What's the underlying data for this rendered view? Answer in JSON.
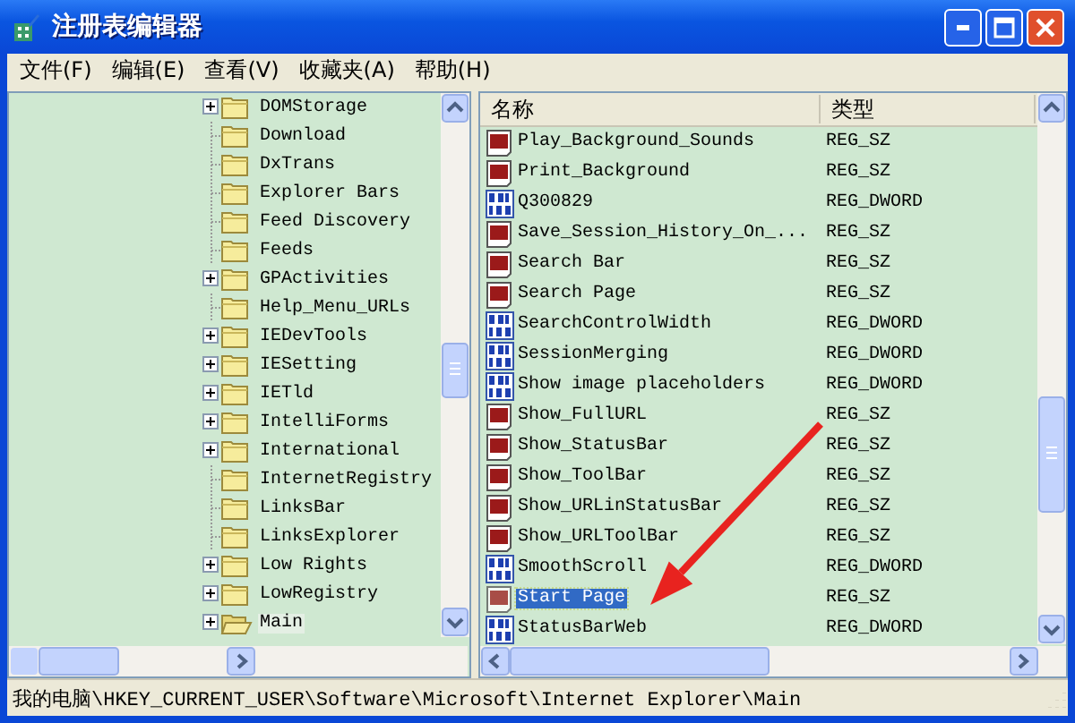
{
  "window": {
    "title": "注册表编辑器"
  },
  "menu": [
    {
      "label": "文件(F)"
    },
    {
      "label": "编辑(E)"
    },
    {
      "label": "查看(V)"
    },
    {
      "label": "收藏夹(A)"
    },
    {
      "label": "帮助(H)"
    }
  ],
  "tree": {
    "items": [
      {
        "label": "DOMStorage",
        "has_children": true,
        "selected": false
      },
      {
        "label": "Download",
        "has_children": false,
        "selected": false
      },
      {
        "label": "DxTrans",
        "has_children": false,
        "selected": false
      },
      {
        "label": "Explorer Bars",
        "has_children": false,
        "selected": false
      },
      {
        "label": "Feed Discovery",
        "has_children": false,
        "selected": false
      },
      {
        "label": "Feeds",
        "has_children": false,
        "selected": false
      },
      {
        "label": "GPActivities",
        "has_children": true,
        "selected": false
      },
      {
        "label": "Help_Menu_URLs",
        "has_children": false,
        "selected": false
      },
      {
        "label": "IEDevTools",
        "has_children": true,
        "selected": false
      },
      {
        "label": "IESetting",
        "has_children": true,
        "selected": false
      },
      {
        "label": "IETld",
        "has_children": true,
        "selected": false
      },
      {
        "label": "IntelliForms",
        "has_children": true,
        "selected": false
      },
      {
        "label": "International",
        "has_children": true,
        "selected": false
      },
      {
        "label": "InternetRegistry",
        "has_children": false,
        "selected": false
      },
      {
        "label": "LinksBar",
        "has_children": false,
        "selected": false
      },
      {
        "label": "LinksExplorer",
        "has_children": false,
        "selected": false
      },
      {
        "label": "Low Rights",
        "has_children": true,
        "selected": false
      },
      {
        "label": "LowRegistry",
        "has_children": true,
        "selected": false
      },
      {
        "label": "Main",
        "has_children": true,
        "selected": true
      }
    ]
  },
  "list": {
    "columns": [
      "名称",
      "类型"
    ],
    "rows": [
      {
        "name": "Play_Background_Sounds",
        "type": "REG_SZ",
        "kind": "string",
        "selected": false
      },
      {
        "name": "Print_Background",
        "type": "REG_SZ",
        "kind": "string",
        "selected": false
      },
      {
        "name": "Q300829",
        "type": "REG_DWORD",
        "kind": "dword",
        "selected": false
      },
      {
        "name": "Save_Session_History_On_...",
        "type": "REG_SZ",
        "kind": "string",
        "selected": false
      },
      {
        "name": "Search Bar",
        "type": "REG_SZ",
        "kind": "string",
        "selected": false
      },
      {
        "name": "Search Page",
        "type": "REG_SZ",
        "kind": "string",
        "selected": false
      },
      {
        "name": "SearchControlWidth",
        "type": "REG_DWORD",
        "kind": "dword",
        "selected": false
      },
      {
        "name": "SessionMerging",
        "type": "REG_DWORD",
        "kind": "dword",
        "selected": false
      },
      {
        "name": "Show image placeholders",
        "type": "REG_DWORD",
        "kind": "dword",
        "selected": false
      },
      {
        "name": "Show_FullURL",
        "type": "REG_SZ",
        "kind": "string",
        "selected": false
      },
      {
        "name": "Show_StatusBar",
        "type": "REG_SZ",
        "kind": "string",
        "selected": false
      },
      {
        "name": "Show_ToolBar",
        "type": "REG_SZ",
        "kind": "string",
        "selected": false
      },
      {
        "name": "Show_URLinStatusBar",
        "type": "REG_SZ",
        "kind": "string",
        "selected": false
      },
      {
        "name": "Show_URLToolBar",
        "type": "REG_SZ",
        "kind": "string",
        "selected": false
      },
      {
        "name": "SmoothScroll",
        "type": "REG_DWORD",
        "kind": "dword",
        "selected": false
      },
      {
        "name": "Start Page",
        "type": "REG_SZ",
        "kind": "string",
        "selected": true
      },
      {
        "name": "StatusBarWeb",
        "type": "REG_DWORD",
        "kind": "dword",
        "selected": false
      }
    ]
  },
  "status_bar": {
    "path": "我的电脑\\HKEY_CURRENT_USER\\Software\\Microsoft\\Internet Explorer\\Main"
  }
}
